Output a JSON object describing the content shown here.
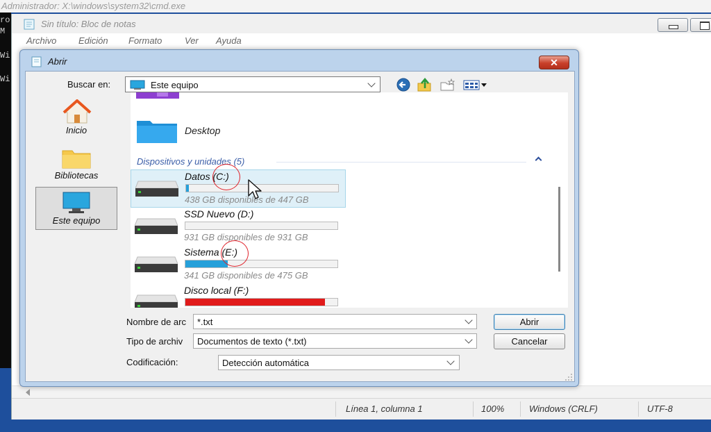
{
  "cmd": {
    "title": "Administrador: X:\\windows\\system32\\cmd.exe",
    "lines": [
      "ro",
      "M",
      "Wi",
      "Wi"
    ]
  },
  "notepad": {
    "title": "Sin título: Bloc de notas",
    "menu": [
      "Archivo",
      "Edición",
      "Formato",
      "Ver",
      "Ayuda"
    ],
    "status": {
      "position": "Línea 1, columna 1",
      "zoom": "100%",
      "line_endings": "Windows (CRLF)",
      "encoding": "UTF-8"
    }
  },
  "dialog": {
    "title": "Abrir",
    "close_glyph": "✕",
    "look_in_label": "Buscar en:",
    "look_in_value": "Este equipo",
    "places": [
      {
        "label": "Inicio",
        "icon": "home-icon"
      },
      {
        "label": "Bibliotecas",
        "icon": "folder-icon"
      },
      {
        "label": "Este equipo",
        "icon": "computer-icon"
      }
    ],
    "file_list": {
      "desktop_label": "Desktop",
      "group_header": "Dispositivos y unidades (5)",
      "drives": [
        {
          "name": "Datos (C:)",
          "free": "438 GB disponibles de 447 GB",
          "used_fraction": 0.02,
          "color": "#26a0da"
        },
        {
          "name": "SSD Nuevo (D:)",
          "free": "931 GB disponibles de 931 GB",
          "used_fraction": 0.0,
          "color": "#26a0da"
        },
        {
          "name": "Sistema (E:)",
          "free": "341 GB disponibles de 475 GB",
          "used_fraction": 0.28,
          "color": "#26a0da"
        },
        {
          "name": "Disco local (F:)",
          "free": "",
          "used_fraction": 0.92,
          "color": "#e11b1b"
        }
      ]
    },
    "filename_label": "Nombre de arc",
    "filename_value": "*.txt",
    "filetype_label": "Tipo de archiv",
    "filetype_value": "Documentos de texto (*.txt)",
    "encoding_label": "Codificación:",
    "encoding_value": "Detección automática",
    "open_button": "Abrir",
    "cancel_button": "Cancelar"
  },
  "colors": {
    "accent": "#26a0da",
    "annotation": "#e0222a",
    "danger_bar": "#e11b1b",
    "close_button": "#c8402a"
  }
}
